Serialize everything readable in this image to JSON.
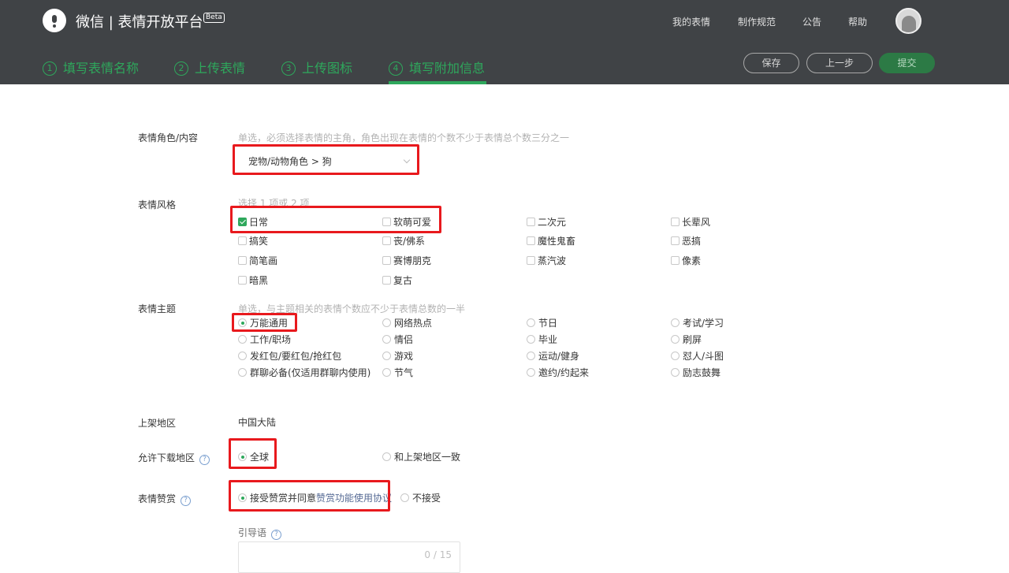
{
  "header": {
    "brand": "微信 | 表情开放平台",
    "beta": "Beta",
    "nav": [
      "我的表情",
      "制作规范",
      "公告",
      "帮助"
    ],
    "steps": [
      {
        "num": "1",
        "label": "填写表情名称"
      },
      {
        "num": "2",
        "label": "上传表情"
      },
      {
        "num": "3",
        "label": "上传图标"
      },
      {
        "num": "4",
        "label": "填写附加信息"
      }
    ],
    "buttons": {
      "save": "保存",
      "prev": "上一步",
      "submit": "提交"
    }
  },
  "role": {
    "label": "表情角色/内容",
    "hint": "单选，必须选择表情的主角，角色出现在表情的个数不少于表情总个数三分之一",
    "value": "宠物/动物角色 > 狗"
  },
  "style": {
    "label": "表情风格",
    "hint": "选择 1 项或 2 项",
    "options": [
      "日常",
      "软萌可爱",
      "二次元",
      "长辈风",
      "搞笑",
      "丧/佛系",
      "魔性鬼畜",
      "恶搞",
      "简笔画",
      "赛博朋克",
      "蒸汽波",
      "像素",
      "暗黑",
      "复古"
    ],
    "checked": "日常"
  },
  "theme": {
    "label": "表情主题",
    "hint": "单选，与主题相关的表情个数应不少于表情总数的一半",
    "options": [
      "万能通用",
      "网络热点",
      "节日",
      "考试/学习",
      "工作/职场",
      "情侣",
      "毕业",
      "刷屏",
      "发红包/要红包/抢红包",
      "游戏",
      "运动/健身",
      "怼人/斗图",
      "群聊必备(仅适用群聊内使用)",
      "节气",
      "邀约/约起来",
      "励志鼓舞"
    ],
    "selected": "万能通用"
  },
  "region": {
    "label": "上架地区",
    "value": "中国大陆"
  },
  "download": {
    "label": "允许下载地区",
    "options": [
      "全球",
      "和上架地区一致"
    ],
    "selected": "全球"
  },
  "reward": {
    "label": "表情赞赏",
    "accept_prefix": "接受赞赏并同意",
    "agreement_link": "赞赏功能使用协议",
    "reject": "不接受",
    "selected": "accept"
  },
  "guide": {
    "label": "引导语",
    "counter": "0 / 15"
  },
  "colors": {
    "accent": "#2ea85c",
    "header_bg": "#404346",
    "highlight": "#e8191d",
    "link": "#576b95"
  }
}
